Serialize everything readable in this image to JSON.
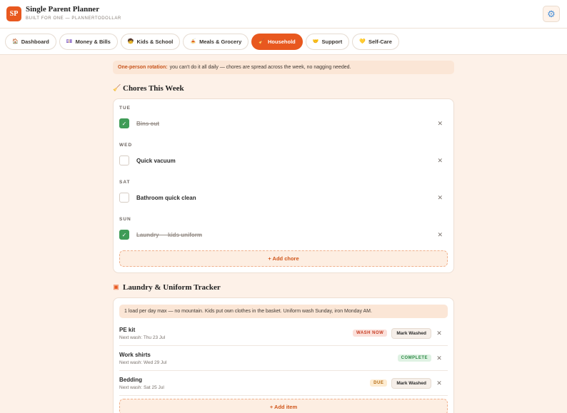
{
  "app": {
    "logo": "SP",
    "title": "Single Parent Planner",
    "subtitle": "BUILT FOR ONE — PLANNERTODOLLAR"
  },
  "tabs": [
    {
      "icon": "🏠",
      "label": "Dashboard"
    },
    {
      "icon": "💷",
      "label": "Money & Bills"
    },
    {
      "icon": "🧒",
      "label": "Kids & School"
    },
    {
      "icon": "🍝",
      "label": "Meals & Grocery"
    },
    {
      "icon": "🧹",
      "label": "Household",
      "active": true
    },
    {
      "icon": "🤝",
      "label": "Support"
    },
    {
      "icon": "💛",
      "label": "Self-Care"
    }
  ],
  "tip": {
    "strong": "One-person rotation:",
    "text": "you can't do it all daily — chores are spread across the week, no nagging needed."
  },
  "chores": {
    "icon": "broom-icon",
    "heading": "Chores This Week",
    "groups": [
      {
        "day": "TUE",
        "name": "Bins out",
        "done": true
      },
      {
        "day": "WED",
        "name": "Quick vacuum",
        "done": false
      },
      {
        "day": "SAT",
        "name": "Bathroom quick clean",
        "done": false
      },
      {
        "day": "SUN",
        "name": "Laundry — kids uniform",
        "done": true
      }
    ],
    "add_label": "+ Add chore"
  },
  "laundry": {
    "icon": "washing-machine-icon",
    "heading": "Laundry & Uniform Tracker",
    "note": "1 load per day max — no mountain. Kids put own clothes in the basket. Uniform wash Sunday, iron Monday AM.",
    "items": [
      {
        "name": "PE kit",
        "next": "Next wash: Thu 23 Jul",
        "status": "WASH NOW",
        "action": "Mark Washed"
      },
      {
        "name": "Work shirts",
        "next": "Next wash: Wed 29 Jul",
        "status": "COMPLETE",
        "action": ""
      },
      {
        "name": "Bedding",
        "next": "Next wash: Sat 25 Jul",
        "status": "DUE",
        "action": "Mark Washed"
      }
    ],
    "add_label": "+ Add item"
  },
  "colors": {
    "accent": "#e8581f",
    "background": "#fdf1e8",
    "done_check": "#3f9c57"
  }
}
